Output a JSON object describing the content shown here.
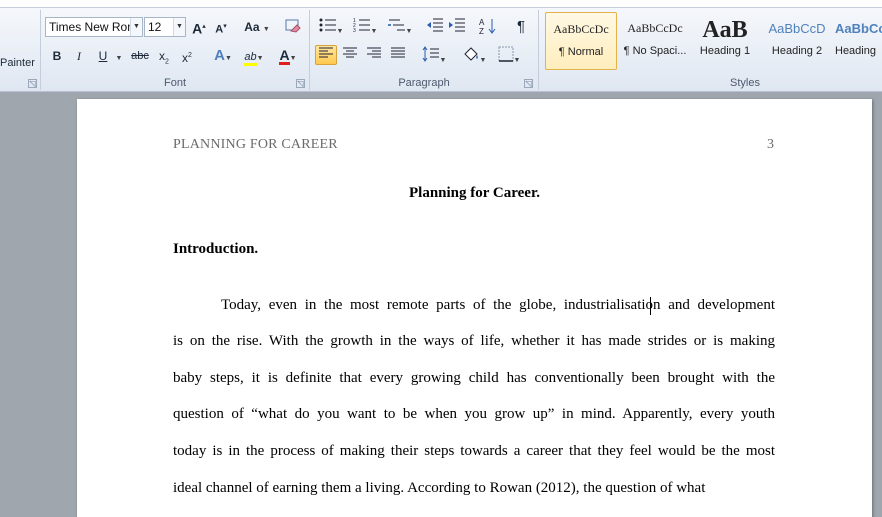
{
  "ribbon": {
    "clipboard": {
      "format_painter_label": "Painter"
    },
    "font": {
      "group_label": "Font",
      "font_name": "Times New Rom",
      "font_size": "12",
      "grow_font": "A",
      "shrink_font": "A",
      "change_case": "Aa",
      "bold": "B",
      "italic": "I",
      "underline": "U",
      "strikethrough": "abc",
      "subscript": "x",
      "superscript": "x",
      "font_color": "A",
      "text_effects": "A",
      "highlight": "ab"
    },
    "paragraph": {
      "group_label": "Paragraph",
      "show_marks": "¶"
    },
    "styles": {
      "group_label": "Styles",
      "items": [
        {
          "sample": "AaBbCcDc",
          "name": "¶ Normal"
        },
        {
          "sample": "AaBbCcDc",
          "name": "¶ No Spaci..."
        },
        {
          "sample": "AaB",
          "name": "Heading 1"
        },
        {
          "sample": "AaBbCcD",
          "name": "Heading 2"
        },
        {
          "sample": "AaBbCc",
          "name": "Heading"
        }
      ]
    },
    "colors": {
      "font_color_bar": "#e0201b",
      "highlight_bar": "#ffff00",
      "heading_blue": "#4f81bd",
      "accent_selected": "#ffc94d"
    }
  },
  "document": {
    "header_title": "PLANNING FOR CAREER",
    "page_number": "3",
    "title": "Planning for Career.",
    "intro_heading": "Introduction.",
    "paragraph_lines": [
      "Today, even in the most remote parts of the globe, industrialisation and development",
      "is on the rise. With the growth in the ways of life, whether it has made strides or is making",
      "baby steps, it is definite that every growing child has conventionally been brought with the",
      "question of “what do you want to be when you grow up” in mind. Apparently, every youth",
      "today is in the process of making their steps towards a career that they feel would be the most",
      "ideal channel of earning them a living.  According to Rowan (2012), the question of what"
    ]
  }
}
